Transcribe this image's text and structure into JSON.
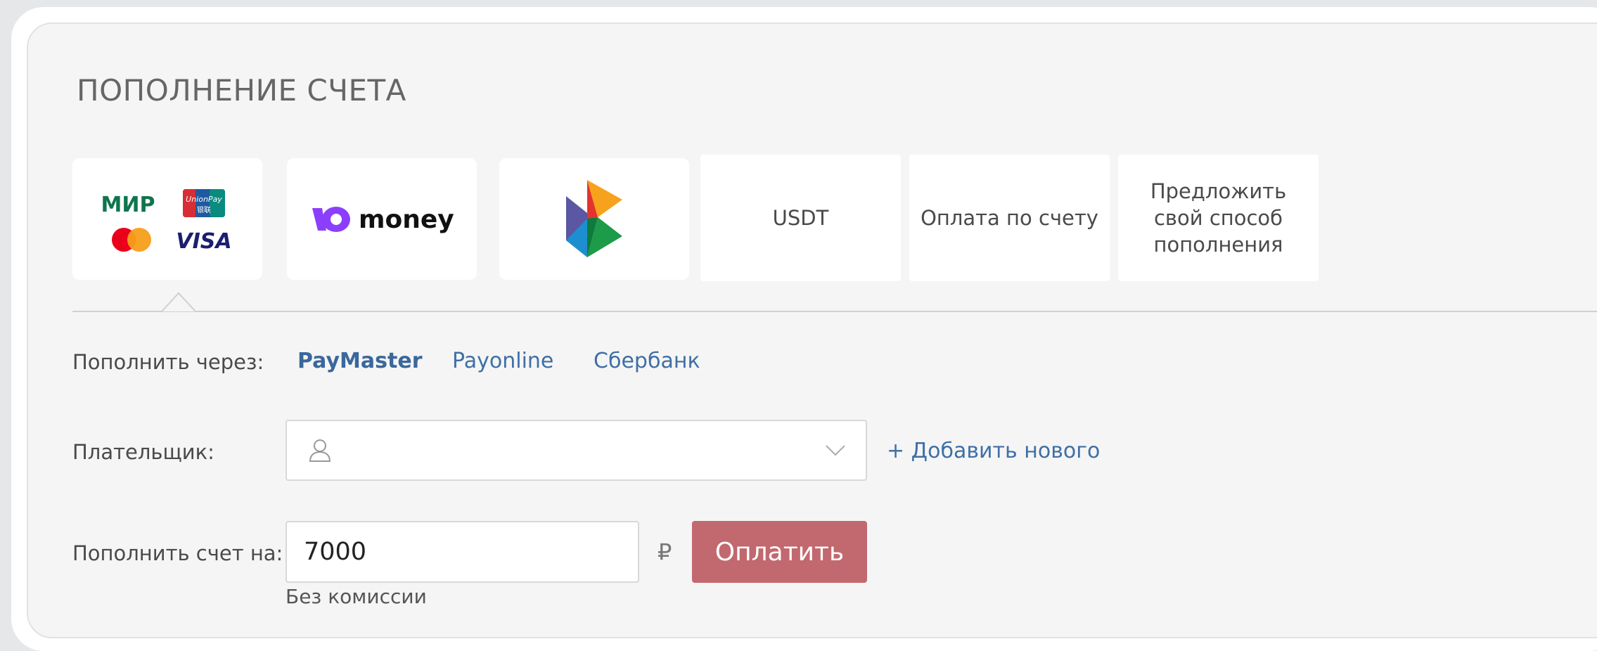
{
  "title": "ПОПОЛНЕНИЕ СЧЕТА",
  "methods": [
    {
      "name": "cards",
      "logos": [
        "МИР",
        "UnionPay",
        "Mastercard",
        "VISA"
      ]
    },
    {
      "name": "yoomoney",
      "text": "money"
    },
    {
      "name": "sbp-logo"
    },
    {
      "name": "usdt",
      "label": "USDT"
    },
    {
      "name": "invoice",
      "label": "Оплата по счету"
    },
    {
      "name": "suggest",
      "label": "Предложить свой способ пополнения"
    }
  ],
  "logos": {
    "mir": "МИР",
    "unionpay_top": "UnionPay",
    "unionpay_bottom": "银联",
    "visa": "VISA",
    "yoomoney_mark": "Ю",
    "yoomoney_text": "money"
  },
  "card_labels": {
    "usdt": "USDT",
    "invoice": "Оплата по счету",
    "suggest_1": "Предложить",
    "suggest_2": "свой способ",
    "suggest_3": "пополнения"
  },
  "providers": {
    "label": "Пополнить через:",
    "items": [
      "PayMaster",
      "Payonline",
      "Сбербанк"
    ],
    "active": "PayMaster"
  },
  "payer": {
    "label": "Плательщик:",
    "value": "",
    "add_link": "+ Добавить нового"
  },
  "amount": {
    "label": "Пополнить счет на:",
    "value": "7000",
    "currency": "₽",
    "note": "Без комиссии",
    "button": "Оплатить"
  },
  "colors": {
    "accent_button": "#c2686f",
    "link": "#3f6fa5",
    "panel_bg": "#f5f5f5"
  },
  "icons": [
    "user-icon",
    "chevron-down-icon"
  ]
}
